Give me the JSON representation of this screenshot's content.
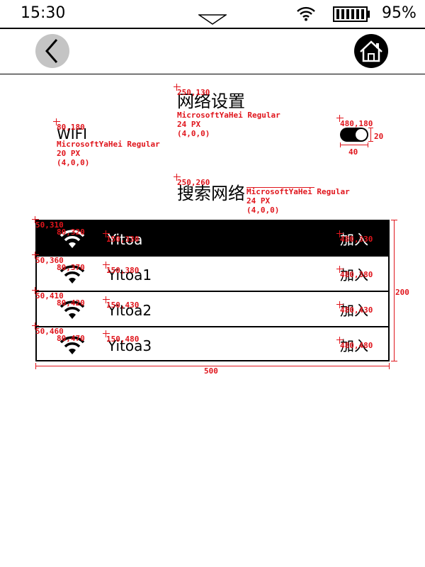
{
  "status_bar": {
    "time": "15:30",
    "battery_percent": "95%",
    "icons": [
      "pull-down-icon",
      "wifi-icon",
      "battery-icon"
    ]
  },
  "nav": {
    "back_icon": "chevron-left-icon",
    "home_icon": "home-icon"
  },
  "page": {
    "title": "网络设置"
  },
  "wifi": {
    "label": "WIFI",
    "enabled": true
  },
  "search": {
    "title": "搜索网络"
  },
  "networks": [
    {
      "ssid": "Yitoa",
      "action": "加入",
      "selected": true
    },
    {
      "ssid": "Yitoa1",
      "action": "加入",
      "selected": false
    },
    {
      "ssid": "Yitoa2",
      "action": "加入",
      "selected": false
    },
    {
      "ssid": "Yitoa3",
      "action": "加入",
      "selected": false
    }
  ],
  "annotations": {
    "title_pos": "250,130",
    "title_font": "MicrosoftYaHei Regular",
    "title_size": "24 PX",
    "title_color": "(4,0,0)",
    "wifi_pos": "80,180",
    "wifi_font": "MicrosoftYaHei Regular",
    "wifi_size": "20 PX",
    "wifi_color": "(4,0,0)",
    "toggle_pos": "480,180",
    "toggle_h": "20",
    "toggle_w": "40",
    "search_pos": "250,260",
    "search_font": "MicrosoftYaHei Regular",
    "search_size": "24 PX",
    "search_color": "(4,0,0)",
    "list_w": "500",
    "list_h": "200",
    "rows": [
      {
        "row": "50,310",
        "icon": "80,320",
        "text": "150,330",
        "join": "480,330"
      },
      {
        "row": "50,360",
        "icon": "80,370",
        "text": "150,380",
        "join": "480,380"
      },
      {
        "row": "50,410",
        "icon": "80,420",
        "text": "150,430",
        "join": "480,430"
      },
      {
        "row": "50,460",
        "icon": "80,470",
        "text": "150,480",
        "join": "480,480"
      }
    ]
  }
}
